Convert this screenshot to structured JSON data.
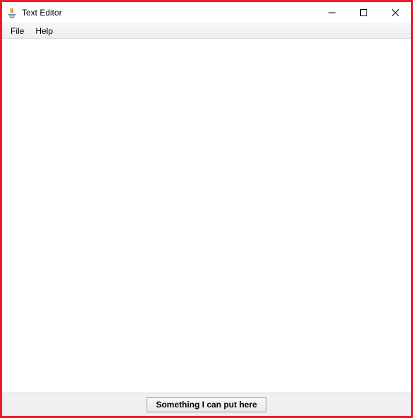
{
  "window": {
    "title": "Text Editor"
  },
  "menubar": {
    "file": "File",
    "help": "Help"
  },
  "editor": {
    "content": ""
  },
  "bottom": {
    "button_label": "Something I can put here"
  }
}
